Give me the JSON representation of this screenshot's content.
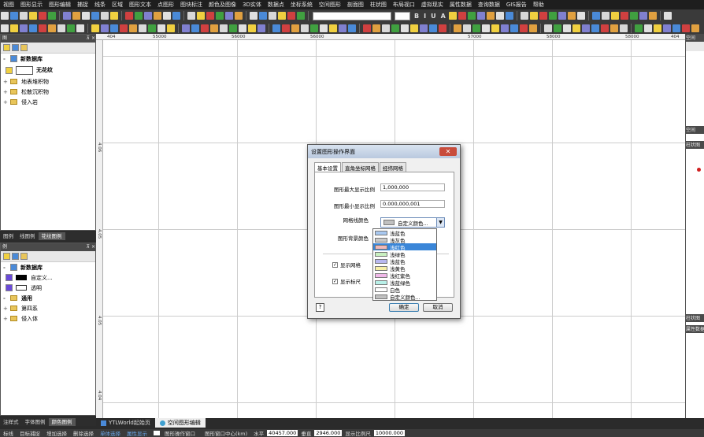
{
  "menubar": {
    "items": [
      "视图",
      "图形显示",
      "图形编辑",
      "捕捉",
      "线条",
      "区域",
      "图形文本",
      "点图形",
      "图块标注",
      "颜色及图像",
      "3D实体",
      "数据点",
      "坐标系统",
      "空间图形",
      "剖面图",
      "柱状图",
      "布局视口",
      "虚拟现实",
      "属性数据",
      "查询数据",
      "GIS报告",
      "帮助"
    ]
  },
  "toolbar": {
    "bold_label": "B",
    "italic_label": "I",
    "underline_label": "U",
    "text_label": "A"
  },
  "left_top_panel": {
    "tree": {
      "root": "新数据库",
      "pattern_label": "无花纹",
      "items": [
        "地表堆积物",
        "松散沉积物",
        "侵入岩"
      ]
    },
    "tabs": [
      "图例",
      "线图例",
      "花纹图例"
    ]
  },
  "left_bottom_panel": {
    "title": "例",
    "tree": {
      "root": "新数据库",
      "items": [
        "自定义...",
        "透明"
      ],
      "group": "通用",
      "group_items": [
        "第四系",
        "侵入体"
      ]
    },
    "tabs": [
      "注样式",
      "字体图例",
      "颜色图例"
    ]
  },
  "canvas": {
    "top_ruler": [
      "404",
      "55000",
      "56000",
      "56000",
      "57000",
      "58000",
      "58000",
      "404"
    ],
    "left_ruler": [
      "4.06",
      "4.05",
      "4.05",
      "4.04"
    ]
  },
  "right_panel": {
    "tabs": [
      "空间",
      "柱状图",
      "柱状图",
      "属性数据"
    ]
  },
  "dialog": {
    "title": "设置图形操作界面",
    "close_label": "✕",
    "tabs": [
      "基本设置",
      "直角坐标网格",
      "经纬网格"
    ],
    "max_scale_label": "图形最大显示比例",
    "max_scale_value": "1,000,000",
    "min_scale_label": "图形最小显示比例",
    "min_scale_value": "0.000,000,001",
    "grid_color_label": "网格线颜色",
    "grid_color_value": "自定义颜色...",
    "bg_color_label": "图形背景颜色",
    "show_grid_label": "显示网格",
    "show_grid_checked": true,
    "show_ruler_label": "显示标尺",
    "show_ruler_checked": true,
    "ok_label": "确定",
    "cancel_label": "取消",
    "help_label": "?",
    "dropdown_options": [
      {
        "label": "浅蓝色",
        "color": "#a8c8f0"
      },
      {
        "label": "浅灰色",
        "color": "#c8c8c8"
      },
      {
        "label": "浅红色",
        "color": "#f0b8b8"
      },
      {
        "label": "浅绿色",
        "color": "#c8f0c0"
      },
      {
        "label": "浅蓝色",
        "color": "#b8b8f0"
      },
      {
        "label": "浅黄色",
        "color": "#f8f0a8"
      },
      {
        "label": "浅红紫色",
        "color": "#f0b8e8"
      },
      {
        "label": "浅蓝绿色",
        "color": "#b8f0e8"
      },
      {
        "label": "白色",
        "color": "#ffffff"
      },
      {
        "label": "自定义颜色...",
        "color": "#c0c0c0"
      }
    ],
    "selected_option": "浅红色"
  },
  "doc_tabs": [
    "YTLWorld起始页",
    "空间图形编辑"
  ],
  "statusbar": {
    "items": [
      "标线",
      "目标捕捉",
      "增加选择",
      "删除选择",
      "单体选择",
      "属性显示"
    ],
    "window_checkbox": "图形操作窗口",
    "coord_label": "图形窗口中心(km)",
    "x_label": "水平",
    "x_value": "40457.000",
    "y_label": "垂直",
    "y_value": "2946.000",
    "scale_label": "显示比例尺",
    "scale_value": "10000.000"
  },
  "colors": {
    "dark_bg": "#2b2b2b",
    "selection_blue": "#3a86d8",
    "dialog_title": "#c9d7ea"
  }
}
